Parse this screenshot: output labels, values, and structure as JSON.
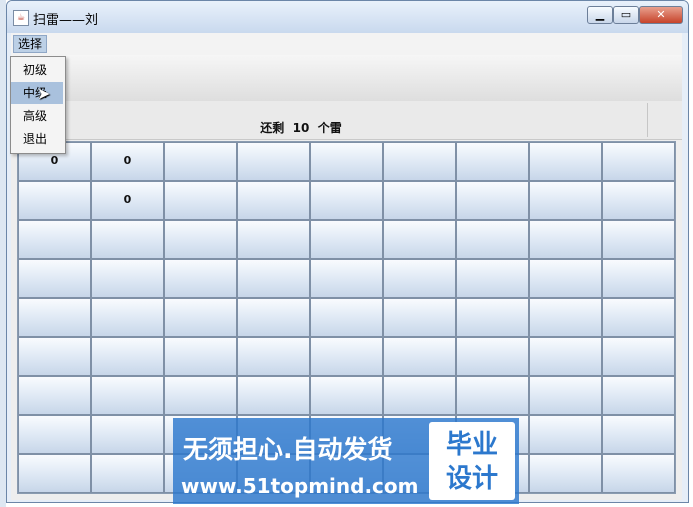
{
  "window": {
    "title": "扫雷——刘",
    "icon": "java-app-icon",
    "controls": [
      "minimize-icon",
      "maximize-icon",
      "close-icon"
    ]
  },
  "menubar": {
    "select_label": "选择"
  },
  "menu_items": [
    {
      "label": "初级",
      "selected": false
    },
    {
      "label": "中级",
      "selected": true
    },
    {
      "label": "高级",
      "selected": false
    },
    {
      "label": "退出",
      "selected": false
    }
  ],
  "status": {
    "prefix": "还剩",
    "count": "10",
    "suffix": "个雷"
  },
  "board": {
    "cols": 9,
    "rows": [
      [
        "0",
        "0",
        "",
        "",
        "",
        "",
        "",
        "",
        ""
      ],
      [
        "",
        "0",
        "",
        "",
        "",
        "",
        "",
        "",
        ""
      ],
      [
        "",
        "",
        "",
        "",
        "",
        "",
        "",
        "",
        ""
      ],
      [
        "",
        "",
        "",
        "",
        "",
        "",
        "",
        "",
        ""
      ],
      [
        "",
        "",
        "",
        "",
        "",
        "",
        "",
        "",
        ""
      ],
      [
        "",
        "",
        "",
        "",
        "",
        "",
        "",
        "",
        ""
      ],
      [
        "",
        "",
        "",
        "",
        "",
        "",
        "",
        "",
        ""
      ],
      [
        "",
        "",
        "",
        "",
        "",
        "",
        "",
        "",
        ""
      ],
      [
        "",
        "",
        "",
        "",
        "",
        "",
        "",
        "",
        ""
      ]
    ]
  },
  "watermark": {
    "text": "无须担心.自动发货",
    "url": "www.51topmind.com",
    "badge": "毕业\n设计",
    "color": "#2c78cd"
  },
  "colors": {
    "accent": "#bcd0e6",
    "close_button": "#c7432a"
  }
}
